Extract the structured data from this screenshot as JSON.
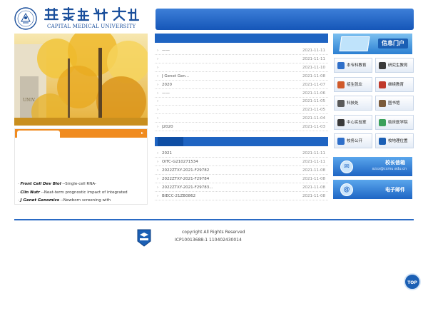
{
  "header": {
    "seal_icon": "university-seal-icon",
    "chinese_name": "首都医科大学",
    "english_name": "CAPITAL MEDICAL UNIVERSITY"
  },
  "topnav": {
    "items": [
      "",
      "",
      "",
      "",
      "",
      "",
      "",
      "",
      "",
      "",
      ""
    ]
  },
  "left_box": {
    "tab_label": "",
    "more_icon": "chevron-right-icon",
    "items": [
      {
        "pre": "",
        "journal": "Front Cell Dev Biol",
        "post": " --Single-cell RNA-"
      },
      {
        "pre": "",
        "journal": "Clin Nutr",
        "post": " --Neat-term prognostic impact of integrated"
      },
      {
        "pre": "",
        "journal": "J Genet Genomics",
        "post": " --Newborn screening with"
      }
    ]
  },
  "news_panel_1": {
    "tab_label": "",
    "more_label": "",
    "rows": [
      {
        "title": "——",
        "date": "2021-11-11"
      },
      {
        "title": "",
        "date": "2021-11-11"
      },
      {
        "title": "",
        "date": "2021-11-10"
      },
      {
        "title": "J Genet Gen...",
        "date": "2021-11-08"
      },
      {
        "title": "2020",
        "date": "2021-11-07"
      },
      {
        "title": "——",
        "date": "2021-11-06"
      },
      {
        "title": "",
        "date": "2021-11-05"
      },
      {
        "title": "",
        "date": "2021-11-05"
      },
      {
        "title": "",
        "date": "2021-11-04"
      },
      {
        "title": "J2020",
        "date": "2021-11-03"
      }
    ]
  },
  "news_panel_2": {
    "tabs": [
      "",
      "",
      "",
      ""
    ],
    "more_label": "",
    "rows": [
      {
        "title": "2021",
        "date": "2021-11-11"
      },
      {
        "title": "OITC-G210271534",
        "date": "2021-11-11"
      },
      {
        "title": "2022ZTXY-2021-F29782",
        "date": "2021-11-08"
      },
      {
        "title": "2022ZTXY-2021-F29784",
        "date": "2021-11-08"
      },
      {
        "title": "2022ZTXY-2021-F29783...",
        "date": "2021-11-08"
      },
      {
        "title": "BIECC-21ZB0862",
        "date": "2021-11-08"
      }
    ]
  },
  "right_column": {
    "info_portal": "信息门户",
    "tiles": [
      {
        "label": "本专科教育",
        "icon": "book-icon"
      },
      {
        "label": "研究生教育",
        "icon": "graduation-cap-icon"
      },
      {
        "label": "招生就业",
        "icon": "student-icon"
      },
      {
        "label": "继续教育",
        "icon": "notebook-icon"
      },
      {
        "label": "科技处",
        "icon": "microscope-icon"
      },
      {
        "label": "图书馆",
        "icon": "library-icon"
      },
      {
        "label": "中心实验室",
        "icon": "lab-icon"
      },
      {
        "label": "临床医学院",
        "icon": "medical-icon"
      },
      {
        "label": "校务公开",
        "icon": "globe-icon"
      },
      {
        "label": "校地理位置",
        "icon": "map-pin-icon"
      }
    ],
    "banner_president": {
      "title": "校长信箱",
      "subtitle": "xzxx@ccmu.edu.cn"
    },
    "banner_email": {
      "title": "电子邮件",
      "badge": "@"
    }
  },
  "footer": {
    "copyright": "copyright All Rights Reserved",
    "icp": "ICP10013688-1 110402430014"
  },
  "top_button": "TOP",
  "colors": {
    "primary": "#1f64c2",
    "accent": "#f08b1f"
  }
}
